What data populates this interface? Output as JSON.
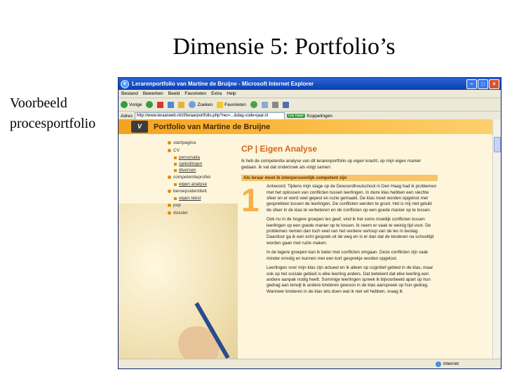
{
  "slide": {
    "title": "Dimensie 5: Portfolio’s",
    "side_line1": "Voorbeeld",
    "side_line2": "procesportfolio"
  },
  "browser": {
    "title": "Lerarenportfolio van Martine de Bruijne - Microsoft Internet Explorer",
    "menu": [
      "Bestand",
      "Bewerken",
      "Beeld",
      "Favorieten",
      "Extra",
      "Help"
    ],
    "toolbar": {
      "back_label": "Vorige",
      "search_label": "Zoeken",
      "favorites_label": "Favorieten"
    },
    "address_label": "Adres",
    "address_value": "http://www.leraarweb.nl/cf/leraarportfolio.php?rec=...&dag-code=jaar.nl",
    "go_label": "Ga naar",
    "links_label": "Koppelingen",
    "status": "Internet"
  },
  "page": {
    "banner_logo": "V",
    "banner_title": "Portfolio van Martine de Bruijne",
    "nav": [
      {
        "label": "startpagina",
        "sub": []
      },
      {
        "label": "CV",
        "sub": [
          "personalia",
          "opleidingen",
          "diversen"
        ]
      },
      {
        "label": "competentieprofiel",
        "sub": [
          "eigen analyse"
        ]
      },
      {
        "label": "beroepsidentiteit",
        "sub": [
          "eigen tekst"
        ]
      },
      {
        "label": "pop",
        "sub": []
      },
      {
        "label": "dossier",
        "sub": []
      }
    ],
    "heading": "CP | Eigen Analyse",
    "intro": "Ik heb de competentie analyse van dit lerarenportfolio op eigen kracht, op mijn eigen manier gedaan. Ik vat dat onderzoek als volgt samen:",
    "section_title": "Als leraar moet ik interpersoonlijk competent zijn",
    "number": "1",
    "answer_p1": "Antwoord: Tijdens mijn stage op de Dewoordhoutschool in Den Haag had ik problemen met het oplossen van conflicten tussen leerlingen. In deze klas hebben een slechte sfeer en er werd veel gepest en ruzie gemaakt. De klas moet worden opgelost met gesprekken tussen de leerlingen. De conflicten werden te groot. Het is mij niet gelukt de sfeer in de klas te verbeteren en de conflicten op een goede manier op te lossen.",
    "answer_p2": "Ook nu in de hogere groepen les geef, vind ik het soms moeilijk conflicten tussen leerlingen op een goede manier op te lossen. Ik neem er vaak te weinig tijd voor. De problemen nemen dan toch veel van het verdere verloop van de les in beslag. Daardoor ga ik een echt gesprek uit de weg en is er dan dat de kinderen na schooltijd worden gaan met ruzie maken.",
    "answer_p3": "In de lagere groepen kan ik beter met conflicten omgaan. Deze conflicten zijn vaak minder ernstig en kunnen met een kort gesprekje worden opgelost.",
    "answer_p4": "Leerlingen voor mijn klas zijn actueel en ik alleen op cognitief gebied in de klas, maar ook op het sociale gebied is elke leerling anders. Dat betekent dat elke leerling een andere aanpak nodig heeft. Sommige leerlingen spreek ik bijvoorbeeld apart op hun gedrag aan terwijl ik andere kinderen gewoon in de klas aanspreek op hun gedrag. Wanneer kinderen in de klas iets doen wat ik niet wil hebben, vraag ik"
  }
}
